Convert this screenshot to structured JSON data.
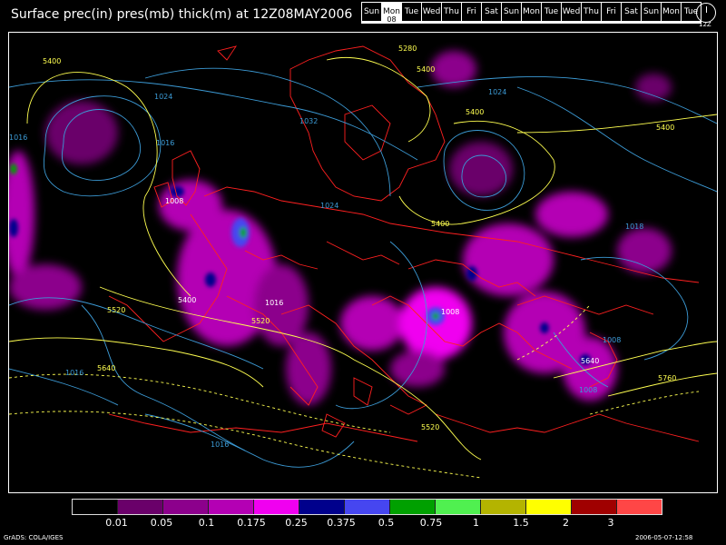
{
  "title": "Surface prec(in) pres(mb) thick(m) at 12Z08MAY2006",
  "day_bar": {
    "days": [
      "Sun",
      "Mon",
      "Tue",
      "Wed",
      "Thu",
      "Fri",
      "Sat",
      "Sun",
      "Mon",
      "Tue",
      "Wed",
      "Thu",
      "Fri",
      "Sat",
      "Sun",
      "Mon",
      "Tue"
    ],
    "active_index": 1,
    "active_date": "08"
  },
  "clock_label": "12Z",
  "legend": {
    "colors": [
      "#000000",
      "#6a006a",
      "#8c008c",
      "#b400b4",
      "#f000f0",
      "#00008c",
      "#4646f0",
      "#00a000",
      "#50f050",
      "#b4b400",
      "#ffff00",
      "#a00000",
      "#ff4646"
    ],
    "labels": [
      "0.01",
      "0.05",
      "0.1",
      "0.175",
      "0.25",
      "0.375",
      "0.5",
      "0.75",
      "1",
      "1.5",
      "2",
      "3"
    ]
  },
  "contour_labels": {
    "pressure": [
      "1016",
      "1024",
      "1032",
      "1016",
      "1008",
      "1024",
      "1024",
      "1018",
      "1016",
      "1008",
      "1008",
      "1008",
      "1016",
      "1016"
    ],
    "thickness": [
      "5400",
      "5280",
      "5400",
      "5400",
      "5400",
      "5400",
      "5400",
      "5520",
      "5520",
      "5640",
      "5760",
      "5640",
      "5520"
    ]
  },
  "map_colors": {
    "pressure": "#3c9bd6",
    "thickness": "#ffff50",
    "coastline": "#ff2020",
    "frame": "#ffffff"
  },
  "footer": {
    "left": "GrADS: COLA/IGES",
    "right": "2006-05-07-12:58"
  }
}
